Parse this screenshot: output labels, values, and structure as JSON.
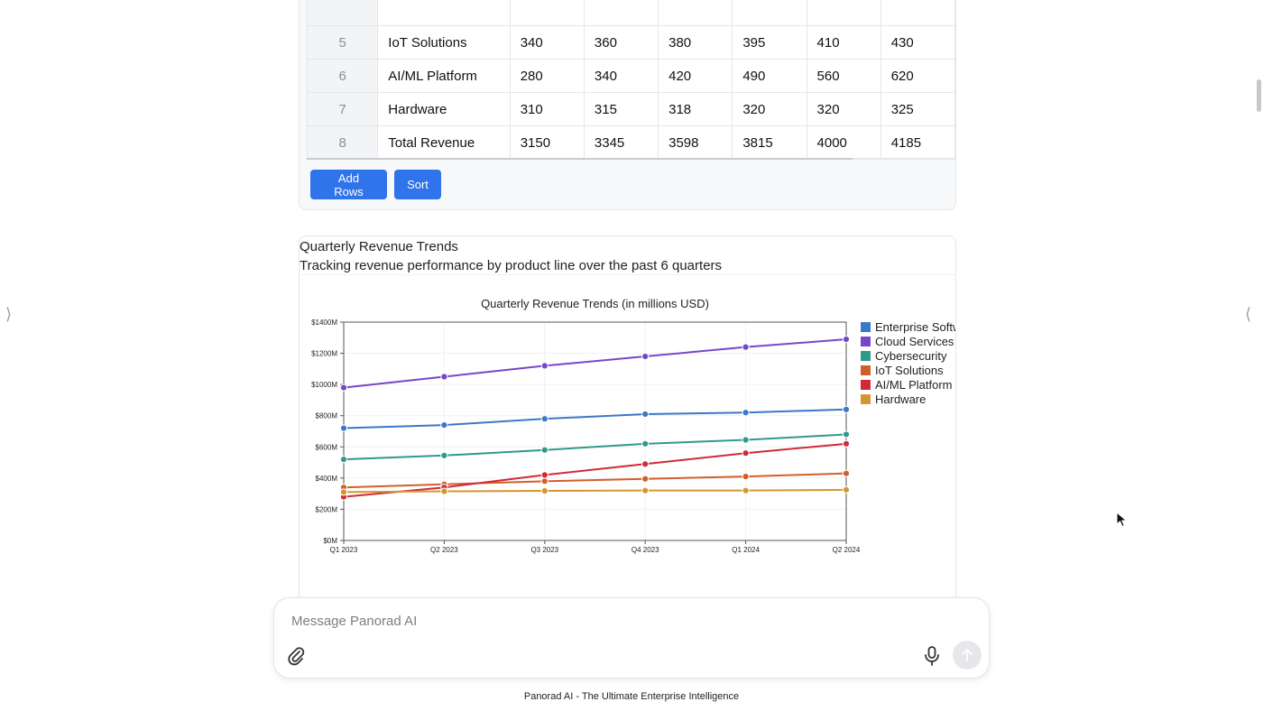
{
  "table": {
    "rows": [
      {
        "num": "5",
        "name": "IoT Solutions",
        "values": [
          "340",
          "360",
          "380",
          "395",
          "410",
          "430"
        ]
      },
      {
        "num": "6",
        "name": "AI/ML Platform",
        "values": [
          "280",
          "340",
          "420",
          "490",
          "560",
          "620"
        ]
      },
      {
        "num": "7",
        "name": "Hardware",
        "values": [
          "310",
          "315",
          "318",
          "320",
          "320",
          "325"
        ]
      },
      {
        "num": "8",
        "name": "Total Revenue",
        "values": [
          "3150",
          "3345",
          "3598",
          "3815",
          "4000",
          "4185"
        ]
      }
    ],
    "add_rows_label": "Add Rows",
    "sort_label": "Sort"
  },
  "chart_card": {
    "title": "Quarterly Revenue Trends",
    "subtitle": "Tracking revenue performance by product line over the past 6 quarters"
  },
  "chart_data": {
    "type": "line",
    "title": "Quarterly Revenue Trends (in millions USD)",
    "categories": [
      "Q1 2023",
      "Q2 2023",
      "Q3 2023",
      "Q4 2023",
      "Q1 2024",
      "Q2 2024"
    ],
    "ylim": [
      0,
      1400
    ],
    "yticks": [
      0,
      200,
      400,
      600,
      800,
      1000,
      1200,
      1400
    ],
    "ytick_labels": [
      "$0M",
      "$200M",
      "$400M",
      "$600M",
      "$800M",
      "$1000M",
      "$1200M",
      "$1400M"
    ],
    "grid": true,
    "legend_position": "right",
    "series": [
      {
        "name": "Enterprise Software",
        "color": "#3a78c9",
        "values": [
          720,
          740,
          780,
          810,
          820,
          840
        ]
      },
      {
        "name": "Cloud Services",
        "color": "#7a46c8",
        "values": [
          980,
          1050,
          1120,
          1180,
          1240,
          1290
        ]
      },
      {
        "name": "Cybersecurity",
        "color": "#2f9a8a",
        "values": [
          520,
          545,
          580,
          620,
          645,
          680
        ]
      },
      {
        "name": "IoT Solutions",
        "color": "#d0602a",
        "values": [
          340,
          360,
          380,
          395,
          410,
          430
        ]
      },
      {
        "name": "AI/ML Platform",
        "color": "#d12a36",
        "values": [
          280,
          340,
          420,
          490,
          560,
          620
        ]
      },
      {
        "name": "Hardware",
        "color": "#d4962e",
        "values": [
          310,
          315,
          318,
          320,
          320,
          325
        ]
      }
    ]
  },
  "composer": {
    "placeholder": "Message Panorad AI"
  },
  "icons": {
    "attach": "paperclip-icon",
    "mic": "microphone-icon",
    "send": "arrow-up-icon"
  },
  "footer": {
    "text": "Panorad AI - The Ultimate Enterprise Intelligence"
  }
}
